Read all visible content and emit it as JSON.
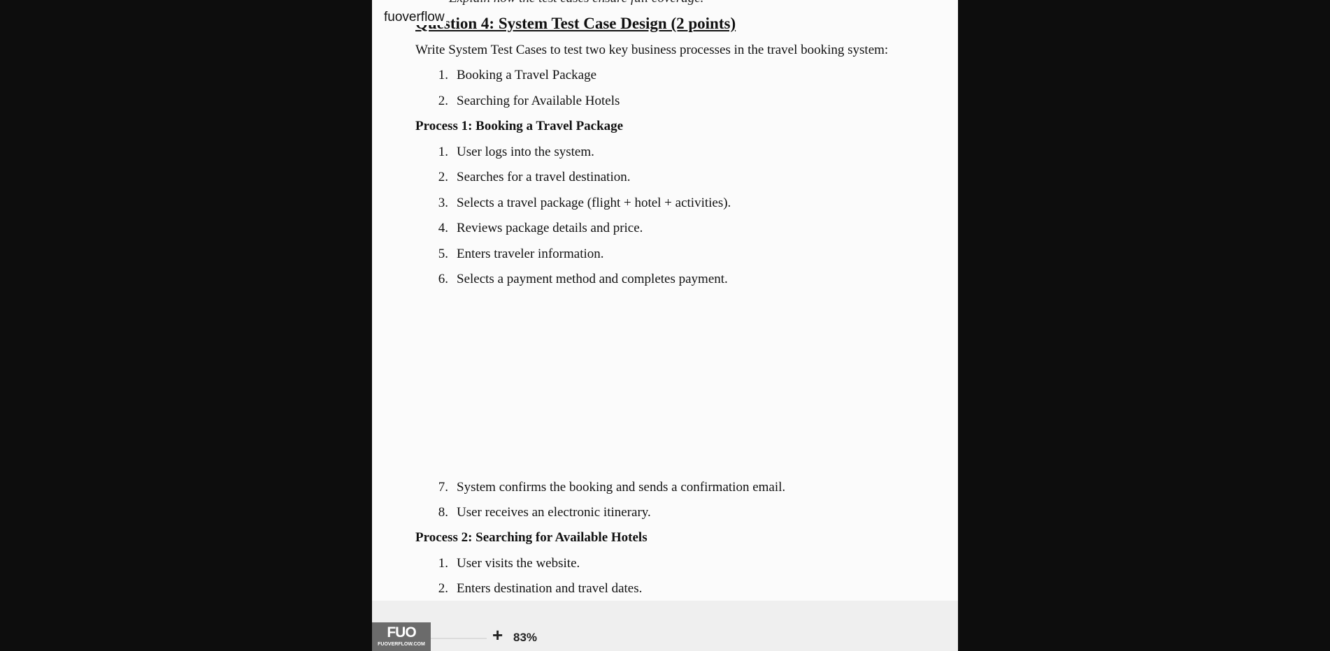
{
  "watermark": "fuoverflow",
  "doc": {
    "clipped_line": "Explain how the test cases ensure full coverage.",
    "clipped_bullet": "•",
    "question_title": "Question 4: System Test Case Design (2 points)",
    "intro": "Write System Test Cases to test two key business processes in the travel booking system:",
    "processes_list": [
      {
        "num": "1.",
        "text": "Booking a Travel Package"
      },
      {
        "num": "2.",
        "text": "Searching for Available Hotels"
      }
    ],
    "process1_heading": "Process 1: Booking a Travel Package",
    "process1_steps": [
      {
        "num": "1.",
        "text": "User logs into the system."
      },
      {
        "num": "2.",
        "text": "Searches for a travel destination."
      },
      {
        "num": "3.",
        "text": "Selects a travel package (flight + hotel + activities)."
      },
      {
        "num": "4.",
        "text": "Reviews package details and price."
      },
      {
        "num": "5.",
        "text": "Enters traveler information."
      },
      {
        "num": "6.",
        "text": "Selects a payment method and completes payment."
      },
      {
        "num": "7.",
        "text": "System confirms the booking and sends a confirmation email."
      },
      {
        "num": "8.",
        "text": "User receives an electronic itinerary."
      }
    ],
    "process2_heading": "Process 2: Searching for Available Hotels",
    "process2_steps": [
      {
        "num": "1.",
        "text": "User visits the website."
      },
      {
        "num": "2.",
        "text": "Enters destination and travel dates."
      }
    ]
  },
  "toolbar": {
    "logo_text": "FUO",
    "logo_subtext": "FUOVERFLOW.COM",
    "zoom_in_label": "+",
    "zoom_level": "83%"
  }
}
